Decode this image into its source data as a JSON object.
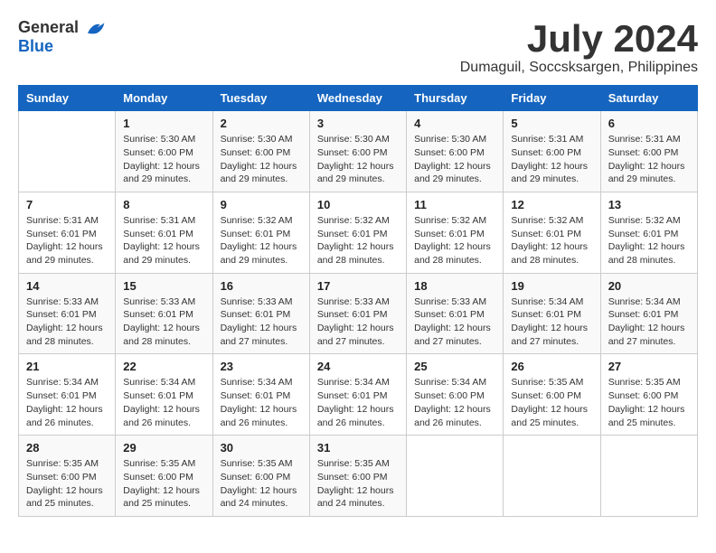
{
  "logo": {
    "general": "General",
    "blue": "Blue"
  },
  "title": "July 2024",
  "subtitle": "Dumaguil, Soccsksargen, Philippines",
  "calendar": {
    "headers": [
      "Sunday",
      "Monday",
      "Tuesday",
      "Wednesday",
      "Thursday",
      "Friday",
      "Saturday"
    ],
    "weeks": [
      [
        {
          "day": "",
          "info": ""
        },
        {
          "day": "1",
          "info": "Sunrise: 5:30 AM\nSunset: 6:00 PM\nDaylight: 12 hours\nand 29 minutes."
        },
        {
          "day": "2",
          "info": "Sunrise: 5:30 AM\nSunset: 6:00 PM\nDaylight: 12 hours\nand 29 minutes."
        },
        {
          "day": "3",
          "info": "Sunrise: 5:30 AM\nSunset: 6:00 PM\nDaylight: 12 hours\nand 29 minutes."
        },
        {
          "day": "4",
          "info": "Sunrise: 5:30 AM\nSunset: 6:00 PM\nDaylight: 12 hours\nand 29 minutes."
        },
        {
          "day": "5",
          "info": "Sunrise: 5:31 AM\nSunset: 6:00 PM\nDaylight: 12 hours\nand 29 minutes."
        },
        {
          "day": "6",
          "info": "Sunrise: 5:31 AM\nSunset: 6:00 PM\nDaylight: 12 hours\nand 29 minutes."
        }
      ],
      [
        {
          "day": "7",
          "info": "Sunrise: 5:31 AM\nSunset: 6:01 PM\nDaylight: 12 hours\nand 29 minutes."
        },
        {
          "day": "8",
          "info": "Sunrise: 5:31 AM\nSunset: 6:01 PM\nDaylight: 12 hours\nand 29 minutes."
        },
        {
          "day": "9",
          "info": "Sunrise: 5:32 AM\nSunset: 6:01 PM\nDaylight: 12 hours\nand 29 minutes."
        },
        {
          "day": "10",
          "info": "Sunrise: 5:32 AM\nSunset: 6:01 PM\nDaylight: 12 hours\nand 28 minutes."
        },
        {
          "day": "11",
          "info": "Sunrise: 5:32 AM\nSunset: 6:01 PM\nDaylight: 12 hours\nand 28 minutes."
        },
        {
          "day": "12",
          "info": "Sunrise: 5:32 AM\nSunset: 6:01 PM\nDaylight: 12 hours\nand 28 minutes."
        },
        {
          "day": "13",
          "info": "Sunrise: 5:32 AM\nSunset: 6:01 PM\nDaylight: 12 hours\nand 28 minutes."
        }
      ],
      [
        {
          "day": "14",
          "info": "Sunrise: 5:33 AM\nSunset: 6:01 PM\nDaylight: 12 hours\nand 28 minutes."
        },
        {
          "day": "15",
          "info": "Sunrise: 5:33 AM\nSunset: 6:01 PM\nDaylight: 12 hours\nand 28 minutes."
        },
        {
          "day": "16",
          "info": "Sunrise: 5:33 AM\nSunset: 6:01 PM\nDaylight: 12 hours\nand 27 minutes."
        },
        {
          "day": "17",
          "info": "Sunrise: 5:33 AM\nSunset: 6:01 PM\nDaylight: 12 hours\nand 27 minutes."
        },
        {
          "day": "18",
          "info": "Sunrise: 5:33 AM\nSunset: 6:01 PM\nDaylight: 12 hours\nand 27 minutes."
        },
        {
          "day": "19",
          "info": "Sunrise: 5:34 AM\nSunset: 6:01 PM\nDaylight: 12 hours\nand 27 minutes."
        },
        {
          "day": "20",
          "info": "Sunrise: 5:34 AM\nSunset: 6:01 PM\nDaylight: 12 hours\nand 27 minutes."
        }
      ],
      [
        {
          "day": "21",
          "info": "Sunrise: 5:34 AM\nSunset: 6:01 PM\nDaylight: 12 hours\nand 26 minutes."
        },
        {
          "day": "22",
          "info": "Sunrise: 5:34 AM\nSunset: 6:01 PM\nDaylight: 12 hours\nand 26 minutes."
        },
        {
          "day": "23",
          "info": "Sunrise: 5:34 AM\nSunset: 6:01 PM\nDaylight: 12 hours\nand 26 minutes."
        },
        {
          "day": "24",
          "info": "Sunrise: 5:34 AM\nSunset: 6:01 PM\nDaylight: 12 hours\nand 26 minutes."
        },
        {
          "day": "25",
          "info": "Sunrise: 5:34 AM\nSunset: 6:00 PM\nDaylight: 12 hours\nand 26 minutes."
        },
        {
          "day": "26",
          "info": "Sunrise: 5:35 AM\nSunset: 6:00 PM\nDaylight: 12 hours\nand 25 minutes."
        },
        {
          "day": "27",
          "info": "Sunrise: 5:35 AM\nSunset: 6:00 PM\nDaylight: 12 hours\nand 25 minutes."
        }
      ],
      [
        {
          "day": "28",
          "info": "Sunrise: 5:35 AM\nSunset: 6:00 PM\nDaylight: 12 hours\nand 25 minutes."
        },
        {
          "day": "29",
          "info": "Sunrise: 5:35 AM\nSunset: 6:00 PM\nDaylight: 12 hours\nand 25 minutes."
        },
        {
          "day": "30",
          "info": "Sunrise: 5:35 AM\nSunset: 6:00 PM\nDaylight: 12 hours\nand 24 minutes."
        },
        {
          "day": "31",
          "info": "Sunrise: 5:35 AM\nSunset: 6:00 PM\nDaylight: 12 hours\nand 24 minutes."
        },
        {
          "day": "",
          "info": ""
        },
        {
          "day": "",
          "info": ""
        },
        {
          "day": "",
          "info": ""
        }
      ]
    ]
  }
}
